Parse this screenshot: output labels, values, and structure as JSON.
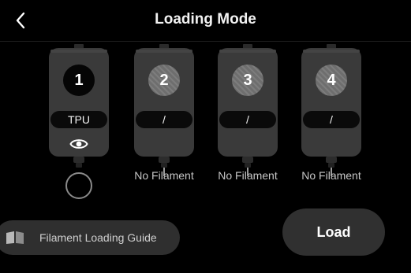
{
  "header": {
    "title": "Loading Mode",
    "back_icon": "chevron-left-icon"
  },
  "slots": [
    {
      "number": "1",
      "filament": "TPU",
      "active": true,
      "status_icon": "eye-icon",
      "status_text": ""
    },
    {
      "number": "2",
      "filament": "/",
      "active": false,
      "status_icon": "",
      "status_text": "No Filament"
    },
    {
      "number": "3",
      "filament": "/",
      "active": false,
      "status_icon": "",
      "status_text": "No Filament"
    },
    {
      "number": "4",
      "filament": "/",
      "active": false,
      "status_icon": "",
      "status_text": "No Filament"
    }
  ],
  "selection": {
    "slot_1_selected": false
  },
  "guide_button": {
    "label": "Filament Loading Guide",
    "icon": "book-icon"
  },
  "load_button": {
    "label": "Load"
  },
  "colors": {
    "background": "#000000",
    "spool_body": "#3a3a3a",
    "button": "#303030"
  }
}
